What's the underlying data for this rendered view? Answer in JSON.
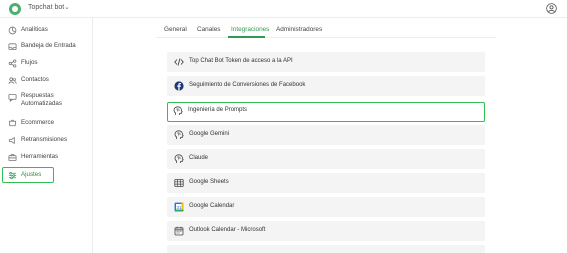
{
  "topbar": {
    "bot_name": "Topchat bot",
    "chevron": "⌄"
  },
  "sidebar": {
    "items": [
      {
        "label": "Analíticas",
        "icon": "chart-icon"
      },
      {
        "label": "Bandeja de Entrada",
        "icon": "inbox-icon"
      },
      {
        "label": "Flujos",
        "icon": "flow-icon"
      },
      {
        "label": "Contactos",
        "icon": "contacts-icon"
      },
      {
        "label": "Respuestas Automatizadas",
        "icon": "auto-reply-icon"
      },
      {
        "label": "Ecommerce",
        "icon": "cart-icon"
      },
      {
        "label": "Retransmisiones",
        "icon": "broadcast-icon"
      },
      {
        "label": "Herramientas",
        "icon": "toolbox-icon"
      },
      {
        "label": "Ajustes",
        "icon": "settings-sliders-icon",
        "active": true
      }
    ]
  },
  "tabs": [
    {
      "label": "General"
    },
    {
      "label": "Canales"
    },
    {
      "label": "Integraciones",
      "active": true
    },
    {
      "label": "Administradores"
    }
  ],
  "integrations": [
    {
      "label": "Top Chat Bot Token de acceso a la API",
      "icon": "code-icon"
    },
    {
      "label": "Seguimiento de Conversiones de Facebook",
      "icon": "facebook-icon"
    },
    {
      "label": "Ingeniería de Prompts",
      "icon": "brain-head-icon",
      "highlight": true
    },
    {
      "label": "Google Gemini",
      "icon": "brain-head-icon"
    },
    {
      "label": "Claude",
      "icon": "brain-head-icon"
    },
    {
      "label": "Google Sheets",
      "icon": "table-icon"
    },
    {
      "label": "Google Calendar",
      "icon": "google-calendar-icon"
    },
    {
      "label": "Outlook Calendar - Microsoft",
      "icon": "calendar-icon"
    }
  ],
  "colors": {
    "accent": "#2fbf55",
    "accent_text": "#2e9b52",
    "item_bg": "#f4f4f4",
    "facebook": "#1877f2"
  }
}
